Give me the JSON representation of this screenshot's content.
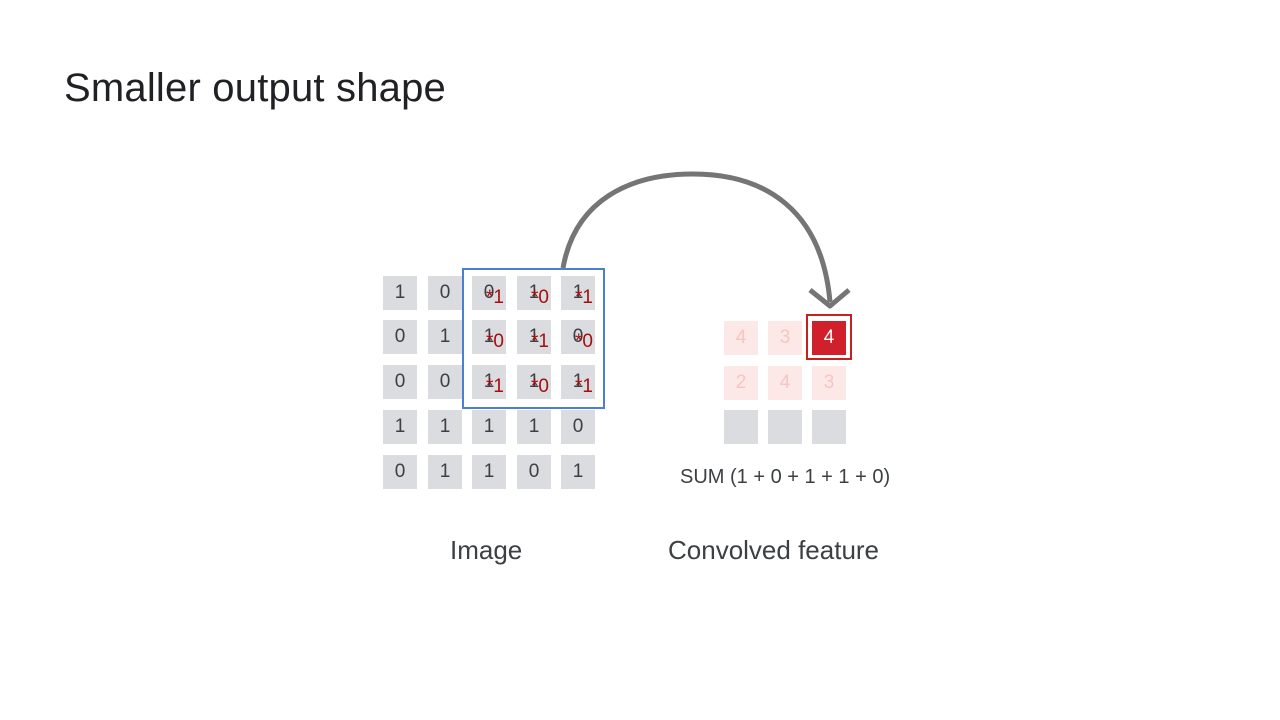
{
  "slide": {
    "title": "Smaller output shape"
  },
  "image_grid": {
    "label": "Image",
    "rows": [
      [
        "1",
        "0",
        "0",
        "1",
        "1"
      ],
      [
        "0",
        "1",
        "1",
        "1",
        "0"
      ],
      [
        "0",
        "0",
        "1",
        "1",
        "1"
      ],
      [
        "1",
        "1",
        "1",
        "1",
        "0"
      ],
      [
        "0",
        "1",
        "1",
        "0",
        "1"
      ]
    ]
  },
  "kernel": {
    "position": {
      "row": 0,
      "col": 2
    },
    "multipliers": [
      [
        "*1",
        "*0",
        "*1"
      ],
      [
        "*0",
        "*1",
        "*0"
      ],
      [
        "*1",
        "*0",
        "*1"
      ]
    ]
  },
  "convolved": {
    "label": "Convolved feature",
    "rows": [
      [
        "4",
        "3",
        "4"
      ],
      [
        "2",
        "4",
        "3"
      ],
      [
        "",
        "",
        ""
      ]
    ],
    "active": {
      "row": 0,
      "col": 2
    },
    "formula": "SUM (1 + 0 + 1 + 1 + 0)"
  },
  "colors": {
    "window_border": "#4a7fd4",
    "multiplier_text": "#a50e0e",
    "active_cell": "#d0202b",
    "faded_cell": "#fce8e6",
    "empty_cell": "#dadce0",
    "arrow": "#757575"
  }
}
